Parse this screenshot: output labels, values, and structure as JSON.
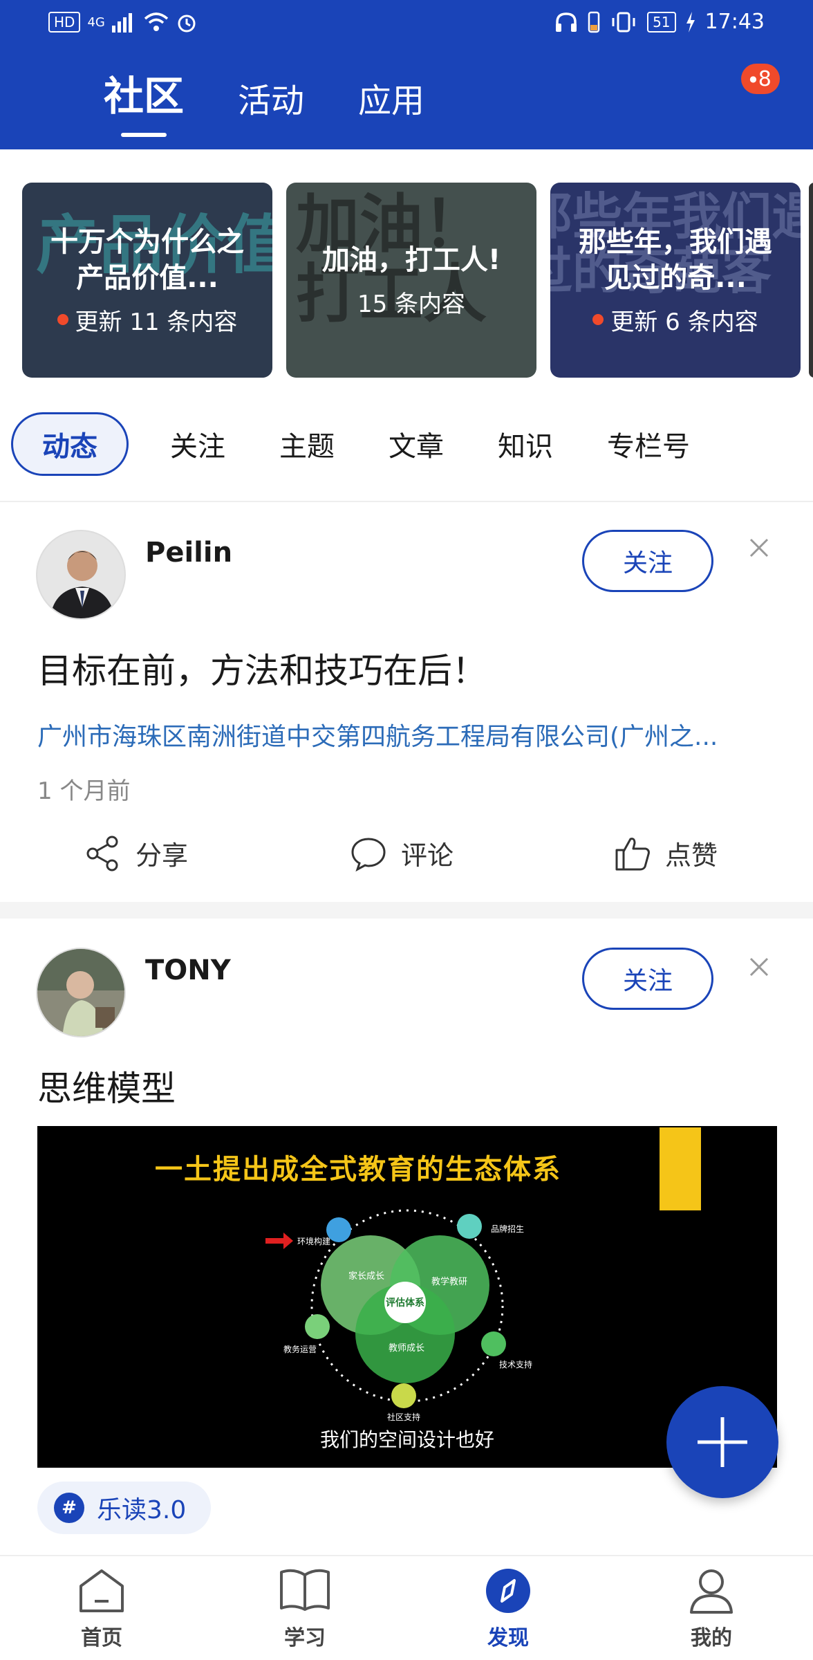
{
  "status_bar": {
    "network": "HD",
    "signal": "4G",
    "battery": "51",
    "time": "17:43"
  },
  "header": {
    "tabs": [
      {
        "label": "社区"
      },
      {
        "label": "活动"
      },
      {
        "label": "应用"
      }
    ],
    "badge_count": "8"
  },
  "cards": [
    {
      "title": "十万个为什么之产品价值...",
      "subtitle": "更新 11 条内容",
      "has_dot": true,
      "bg_text": "产品价值塑造"
    },
    {
      "title": "加油，打工人!",
      "subtitle": "15 条内容",
      "has_dot": false,
      "bg_text": "加油！打工人"
    },
    {
      "title": "那些年，我们遇见过的奇...",
      "subtitle": "更新 6 条内容",
      "has_dot": true,
      "bg_text": "那些年我们遇见过的奇葩客"
    }
  ],
  "filters": [
    {
      "label": "动态"
    },
    {
      "label": "关注"
    },
    {
      "label": "主题"
    },
    {
      "label": "文章"
    },
    {
      "label": "知识"
    },
    {
      "label": "专栏号"
    }
  ],
  "posts": [
    {
      "username": "Peilin",
      "follow_label": "关注",
      "text": "目标在前，方法和技巧在后！",
      "location": "广州市海珠区南洲街道中交第四航务工程局有限公司(广州之...",
      "timestamp": "1 个月前",
      "actions": {
        "share": "分享",
        "comment": "评论",
        "like": "点赞"
      }
    },
    {
      "username": "TONY",
      "follow_label": "关注",
      "text": "思维模型",
      "image": {
        "title": "一土提出成全式教育的生态体系",
        "caption": "我们的空间设计也好",
        "center": "评估体系",
        "circles": [
          "家长成长",
          "教学教研",
          "教师成长"
        ],
        "nodes": [
          "环境构建",
          "品牌招生",
          "教务运营",
          "技术支持",
          "社区支持"
        ]
      },
      "tag": "乐读3.0"
    }
  ],
  "bottom_nav": [
    {
      "label": "首页"
    },
    {
      "label": "学习"
    },
    {
      "label": "发现"
    },
    {
      "label": "我的"
    }
  ],
  "colors": {
    "brand": "#1a44b8",
    "badge": "#f04a2b",
    "link": "#2b6bb8"
  }
}
